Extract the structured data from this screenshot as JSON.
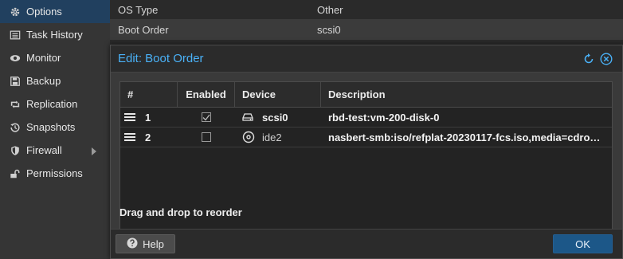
{
  "sidebar": {
    "items": [
      {
        "label": "Options",
        "icon": "gear-icon",
        "active": true
      },
      {
        "label": "Task History",
        "icon": "list-icon"
      },
      {
        "label": "Monitor",
        "icon": "eye-icon"
      },
      {
        "label": "Backup",
        "icon": "floppy-icon"
      },
      {
        "label": "Replication",
        "icon": "retweet-icon"
      },
      {
        "label": "Snapshots",
        "icon": "history-icon"
      },
      {
        "label": "Firewall",
        "icon": "shield-icon"
      },
      {
        "label": "Permissions",
        "icon": "unlock-icon"
      }
    ]
  },
  "options_table": {
    "rows": [
      {
        "key": "OS Type",
        "value": "Other"
      },
      {
        "key": "Boot Order",
        "value": "scsi0"
      }
    ]
  },
  "dialog": {
    "title": "Edit: Boot Order",
    "columns": {
      "num": "#",
      "enabled": "Enabled",
      "device": "Device",
      "description": "Description"
    },
    "rows": [
      {
        "num": "1",
        "enabled": true,
        "device": "scsi0",
        "device_icon": "hdd-icon",
        "description": "rbd-test:vm-200-disk-0"
      },
      {
        "num": "2",
        "enabled": false,
        "device": "ide2",
        "device_icon": "cdrom-icon",
        "description": "nasbert-smb:iso/refplat-20230117-fcs.iso,media=cdrom,s..."
      }
    ],
    "hint": "Drag and drop to reorder",
    "help_label": "Help",
    "ok_label": "OK"
  },
  "colors": {
    "accent": "#4ab1f7",
    "active_nav": "#21405f",
    "ok_button": "#1c5788"
  }
}
